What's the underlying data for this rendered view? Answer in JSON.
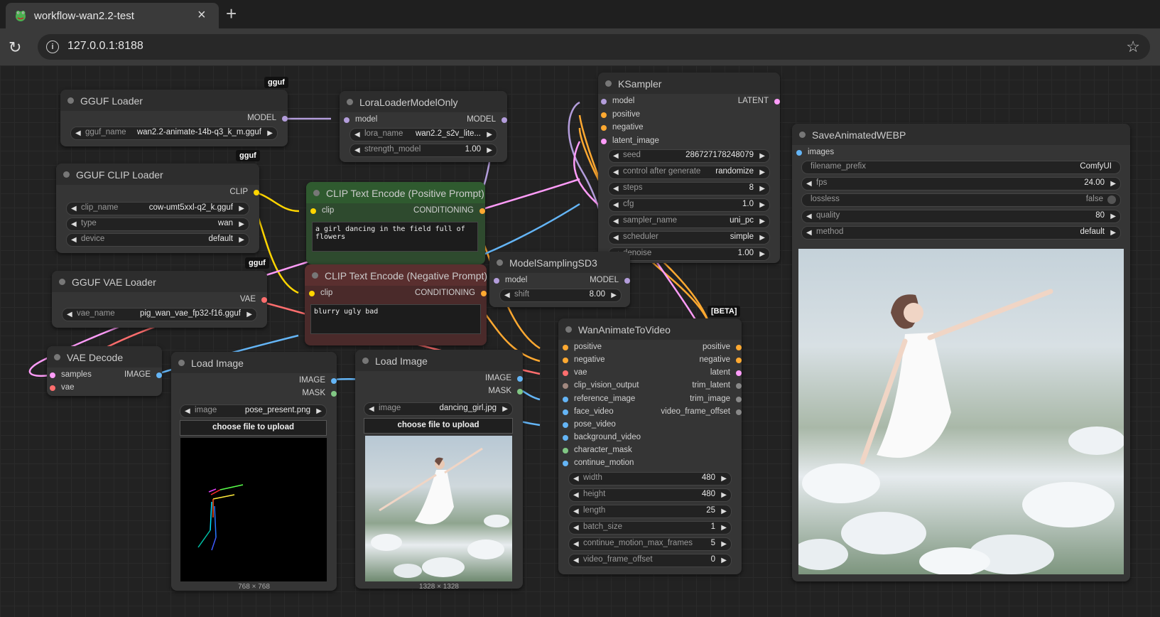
{
  "browser": {
    "tab_title": "workflow-wan2.2-test",
    "url": "127.0.0.1:8188"
  },
  "colors": {
    "model": "#b39ddb",
    "clip": "#ffd500",
    "vae": "#ff6e6e",
    "conditioning": "#ffa931",
    "latent": "#ff9cf9",
    "image": "#64b5f6",
    "mask": "#81c784",
    "clip_vision": "#a1887f"
  },
  "nodes": {
    "gguf_loader": {
      "badge": "gguf",
      "title": "GGUF Loader",
      "out_model": "MODEL",
      "w_gguf_name_label": "gguf_name",
      "w_gguf_name_value": "wan2.2-animate-14b-q3_k_m.gguf"
    },
    "lora_loader": {
      "title": "LoraLoaderModelOnly",
      "in_model": "model",
      "out_model": "MODEL",
      "w_lora_name_label": "lora_name",
      "w_lora_name_value": "wan2.2_s2v_lite...",
      "w_strength_label": "strength_model",
      "w_strength_value": "1.00"
    },
    "gguf_clip_loader": {
      "badge": "gguf",
      "title": "GGUF CLIP Loader",
      "out_clip": "CLIP",
      "w_clip_name_label": "clip_name",
      "w_clip_name_value": "cow-umt5xxl-q2_k.gguf",
      "w_type_label": "type",
      "w_type_value": "wan",
      "w_device_label": "device",
      "w_device_value": "default"
    },
    "clip_pos": {
      "title": "CLIP Text Encode (Positive Prompt)",
      "in_clip": "clip",
      "out_cond": "CONDITIONING",
      "text": "a girl dancing in the field full of flowers"
    },
    "clip_neg": {
      "title": "CLIP Text Encode (Negative Prompt)",
      "in_clip": "clip",
      "out_cond": "CONDITIONING",
      "text": "blurry ugly bad"
    },
    "gguf_vae_loader": {
      "badge": "gguf",
      "title": "GGUF VAE Loader",
      "out_vae": "VAE",
      "w_vae_name_label": "vae_name",
      "w_vae_name_value": "pig_wan_vae_fp32-f16.gguf"
    },
    "vae_decode": {
      "title": "VAE Decode",
      "in_samples": "samples",
      "in_vae": "vae",
      "out_image": "IMAGE"
    },
    "load_image_1": {
      "title": "Load Image",
      "out_image": "IMAGE",
      "out_mask": "MASK",
      "w_image_label": "image",
      "w_image_value": "pose_present.png",
      "upload": "choose file to upload",
      "dims": "768 × 768"
    },
    "load_image_2": {
      "title": "Load Image",
      "out_image": "IMAGE",
      "out_mask": "MASK",
      "w_image_label": "image",
      "w_image_value": "dancing_girl.jpg",
      "upload": "choose file to upload",
      "dims": "1328 × 1328"
    },
    "ksampler": {
      "title": "KSampler",
      "in_model": "model",
      "in_positive": "positive",
      "in_negative": "negative",
      "in_latent": "latent_image",
      "out_latent": "LATENT",
      "w_seed_label": "seed",
      "w_seed_value": "286727178248079",
      "w_control_label": "control after generate",
      "w_control_value": "randomize",
      "w_steps_label": "steps",
      "w_steps_value": "8",
      "w_cfg_label": "cfg",
      "w_cfg_value": "1.0",
      "w_sampler_label": "sampler_name",
      "w_sampler_value": "uni_pc",
      "w_scheduler_label": "scheduler",
      "w_scheduler_value": "simple",
      "w_denoise_label": "denoise",
      "w_denoise_value": "1.00"
    },
    "model_sampling": {
      "title": "ModelSamplingSD3",
      "in_model": "model",
      "out_model": "MODEL",
      "w_shift_label": "shift",
      "w_shift_value": "8.00"
    },
    "wan_animate": {
      "badge": "[BETA]",
      "title": "WanAnimateToVideo",
      "inputs": [
        "positive",
        "negative",
        "vae",
        "clip_vision_output",
        "reference_image",
        "face_video",
        "pose_video",
        "background_video",
        "character_mask",
        "continue_motion"
      ],
      "outputs": [
        "positive",
        "negative",
        "latent",
        "trim_latent",
        "trim_image",
        "video_frame_offset"
      ],
      "w_width_label": "width",
      "w_width_value": "480",
      "w_height_label": "height",
      "w_height_value": "480",
      "w_length_label": "length",
      "w_length_value": "25",
      "w_batch_label": "batch_size",
      "w_batch_value": "1",
      "w_cmmf_label": "continue_motion_max_frames",
      "w_cmmf_value": "5",
      "w_vfo_label": "video_frame_offset",
      "w_vfo_value": "0"
    },
    "save_webp": {
      "title": "SaveAnimatedWEBP",
      "in_images": "images",
      "w_prefix_label": "filename_prefix",
      "w_prefix_value": "ComfyUI",
      "w_fps_label": "fps",
      "w_fps_value": "24.00",
      "w_lossless_label": "lossless",
      "w_lossless_value": "false",
      "w_quality_label": "quality",
      "w_quality_value": "80",
      "w_method_label": "method",
      "w_method_value": "default"
    }
  }
}
